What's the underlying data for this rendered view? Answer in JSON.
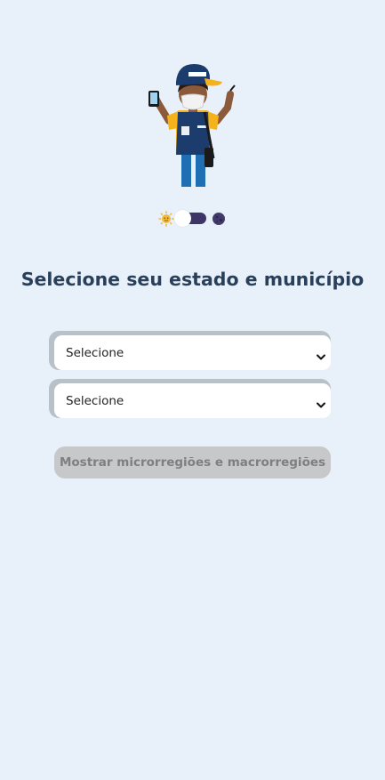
{
  "mascot": {
    "cap_text": "IBGE",
    "icon": "census-agent-illustration"
  },
  "theme_toggle": {
    "light_icon": "sun-icon",
    "dark_icon": "moon-icon",
    "state": "light"
  },
  "title": "Selecione seu estado e município",
  "state_select": {
    "value": "Selecione",
    "icon": "chevron-down-icon"
  },
  "city_select": {
    "value": "Selecione",
    "icon": "chevron-down-icon"
  },
  "show_button": {
    "label": "Mostrar microrregiões e macrorregiões",
    "enabled": false
  },
  "colors": {
    "background": "#e8f1fa",
    "title": "#2a3f5a",
    "select_border": "#b8c0c8",
    "button_disabled": "#c6c8ca",
    "button_text": "#7f7f7f",
    "toggle_track": "#3c3566"
  }
}
